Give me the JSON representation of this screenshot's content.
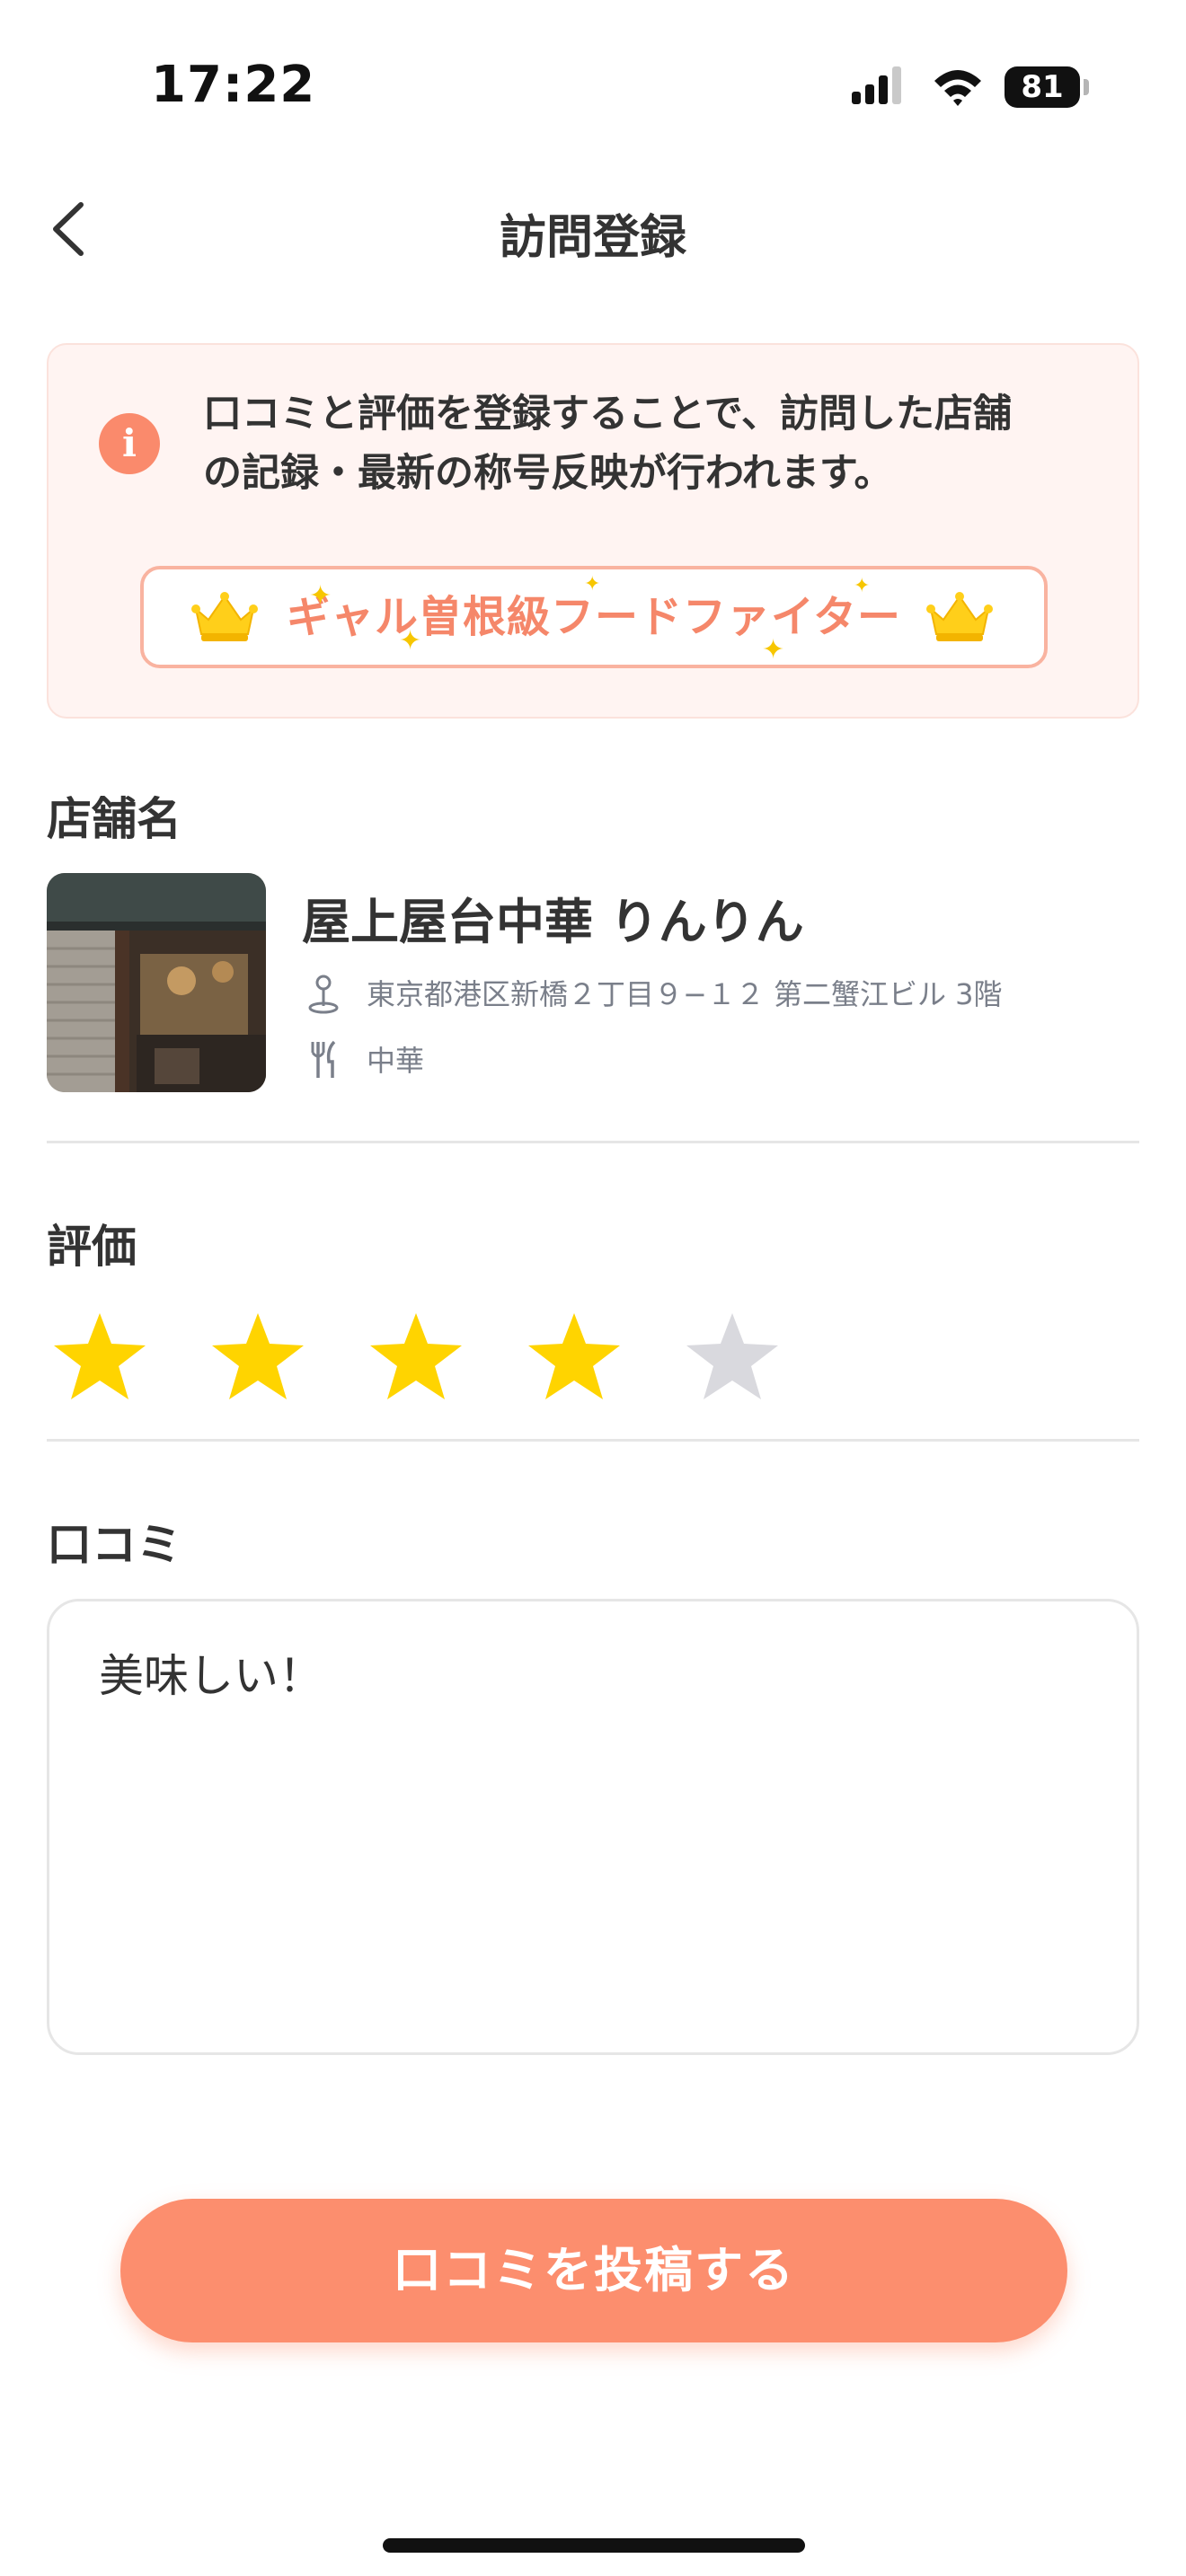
{
  "status_bar": {
    "time": "17:22",
    "battery": "81"
  },
  "nav": {
    "title": "訪問登録"
  },
  "info": {
    "line1": "口コミと評価を登録することで、訪問した店舗",
    "line2": "の記録・最新の称号反映が行われます。",
    "badge_title": "ギャル曽根級フードファイター"
  },
  "store": {
    "section_label": "店舗名",
    "name": "屋上屋台中華 りんりん",
    "address": "東京都港区新橋２丁目９−１２ 第二蟹江ビル 3階",
    "genre": "中華"
  },
  "rating": {
    "section_label": "評価",
    "value": 4,
    "max": 5
  },
  "review": {
    "section_label": "口コミ",
    "text": "美味しい！"
  },
  "submit": {
    "label": "口コミを投稿する"
  },
  "colors": {
    "accent": "#fc8e6c",
    "star_on": "#ffd400",
    "star_off": "#d9d9de"
  },
  "icons": [
    "back-chevron-icon",
    "info-icon",
    "crown-icon",
    "location-pin-icon",
    "fork-knife-icon",
    "star-icon"
  ]
}
